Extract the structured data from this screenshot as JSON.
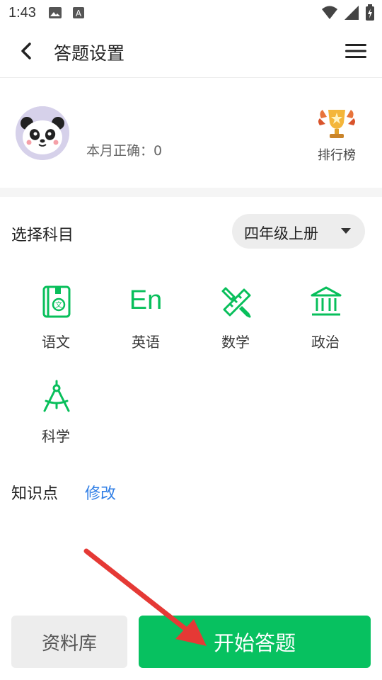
{
  "status_bar": {
    "time": "1:43",
    "icons": [
      "image-icon",
      "text-box-icon",
      "wifi-icon",
      "cellular-signal-icon",
      "battery-charging-icon"
    ]
  },
  "header": {
    "title": "答题设置",
    "back_icon": "chevron-left-icon",
    "menu_icon": "hamburger-menu-icon"
  },
  "profile": {
    "avatar_icon": "panda-avatar",
    "accuracy_text": "本月正确：0",
    "leaderboard_label": "排行榜",
    "leaderboard_icon": "trophy-icon"
  },
  "subject_select": {
    "label": "选择科目",
    "grade_value": "四年级上册"
  },
  "subjects": [
    {
      "label": "语文",
      "icon": "chinese-book-icon"
    },
    {
      "label": "英语",
      "icon": "En"
    },
    {
      "label": "数学",
      "icon": "pencil-ruler-icon"
    },
    {
      "label": "政治",
      "icon": "government-building-icon"
    },
    {
      "label": "科学",
      "icon": "compass-icon"
    }
  ],
  "knowledge": {
    "label": "知识点",
    "edit_label": "修改"
  },
  "buttons": {
    "library_label": "资料库",
    "start_label": "开始答题"
  },
  "colors": {
    "accent": "#07c160",
    "icon_green": "#08bf5b",
    "link_blue": "#2f7ee6",
    "annotation_red": "#e53935"
  }
}
